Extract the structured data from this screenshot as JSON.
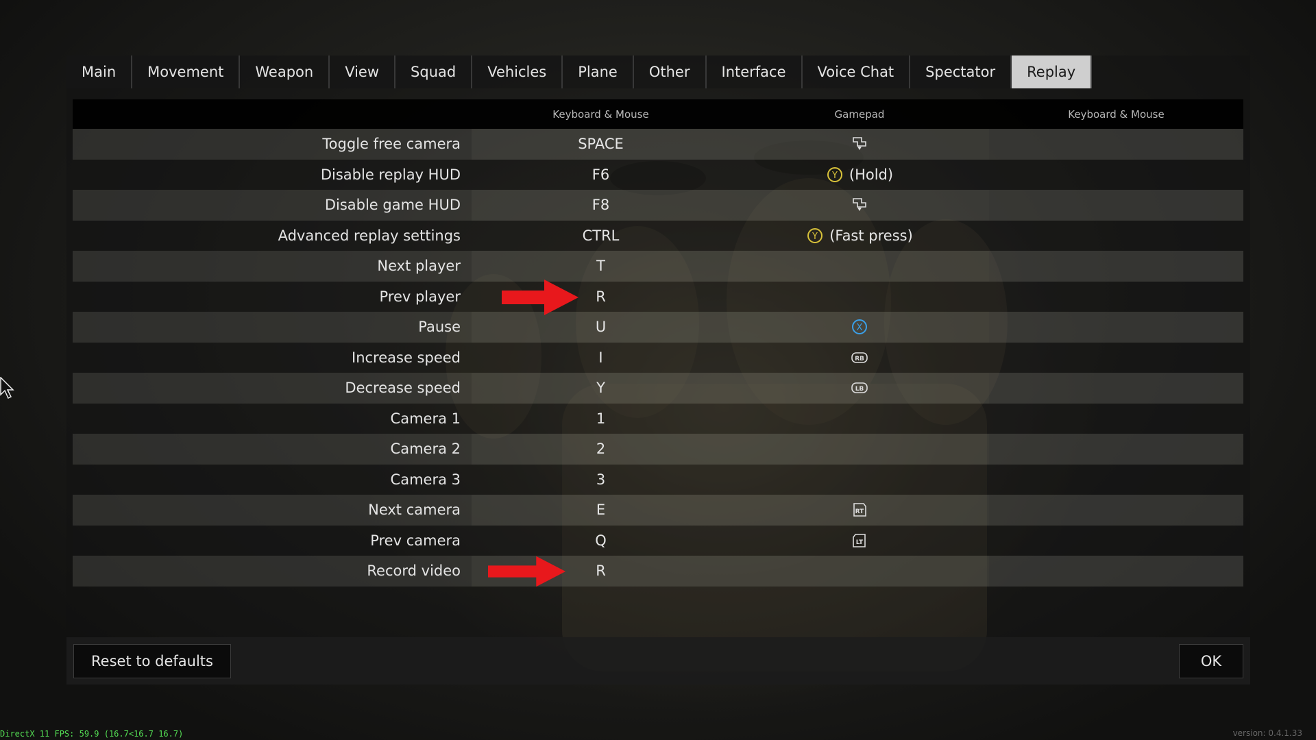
{
  "tabs": [
    "Main",
    "Movement",
    "Weapon",
    "View",
    "Squad",
    "Vehicles",
    "Plane",
    "Other",
    "Interface",
    "Voice Chat",
    "Spectator",
    "Replay"
  ],
  "active_tab": "Replay",
  "table": {
    "headers": [
      "Keyboard & Mouse",
      "Gamepad",
      "Keyboard & Mouse"
    ],
    "rows": [
      {
        "action": "Toggle free camera",
        "kbm": "SPACE",
        "pad_icon": "dpad-down-icon",
        "pad_text": "",
        "kbm2": ""
      },
      {
        "action": "Disable replay HUD",
        "kbm": "F6",
        "pad_icon": "y-button-icon",
        "pad_text": "(Hold)",
        "kbm2": ""
      },
      {
        "action": "Disable game HUD",
        "kbm": "F8",
        "pad_icon": "dpad-down-icon",
        "pad_text": "",
        "kbm2": ""
      },
      {
        "action": "Advanced replay settings",
        "kbm": "CTRL",
        "pad_icon": "y-button-icon",
        "pad_text": "(Fast press)",
        "kbm2": ""
      },
      {
        "action": "Next player",
        "kbm": "T",
        "pad_icon": "",
        "pad_text": "",
        "kbm2": ""
      },
      {
        "action": "Prev player",
        "kbm": "R",
        "pad_icon": "",
        "pad_text": "",
        "kbm2": ""
      },
      {
        "action": "Pause",
        "kbm": "U",
        "pad_icon": "x-button-icon",
        "pad_text": "",
        "kbm2": ""
      },
      {
        "action": "Increase speed",
        "kbm": "I",
        "pad_icon": "rb-button-icon",
        "pad_text": "",
        "kbm2": ""
      },
      {
        "action": "Decrease speed",
        "kbm": "Y",
        "pad_icon": "lb-button-icon",
        "pad_text": "",
        "kbm2": ""
      },
      {
        "action": "Camera 1",
        "kbm": "1",
        "pad_icon": "",
        "pad_text": "",
        "kbm2": ""
      },
      {
        "action": "Camera 2",
        "kbm": "2",
        "pad_icon": "",
        "pad_text": "",
        "kbm2": ""
      },
      {
        "action": "Camera 3",
        "kbm": "3",
        "pad_icon": "",
        "pad_text": "",
        "kbm2": ""
      },
      {
        "action": "Next camera",
        "kbm": "E",
        "pad_icon": "rt-button-icon",
        "pad_text": "",
        "kbm2": ""
      },
      {
        "action": "Prev camera",
        "kbm": "Q",
        "pad_icon": "lt-button-icon",
        "pad_text": "",
        "kbm2": ""
      },
      {
        "action": "Record video",
        "kbm": "R",
        "pad_icon": "",
        "pad_text": "",
        "kbm2": ""
      }
    ]
  },
  "footer": {
    "reset_label": "Reset to defaults",
    "ok_label": "OK"
  },
  "annotations": {
    "arrow_color": "#e8181c"
  },
  "status": {
    "fps": "DirectX 11 FPS: 59.9 (16.7<16.7 16.7)",
    "version": "version: 0.4.1.33"
  },
  "colors": {
    "active_tab_bg": "#cfcfcf",
    "y_button": "#d8c23a",
    "x_button": "#3aa0e8"
  }
}
